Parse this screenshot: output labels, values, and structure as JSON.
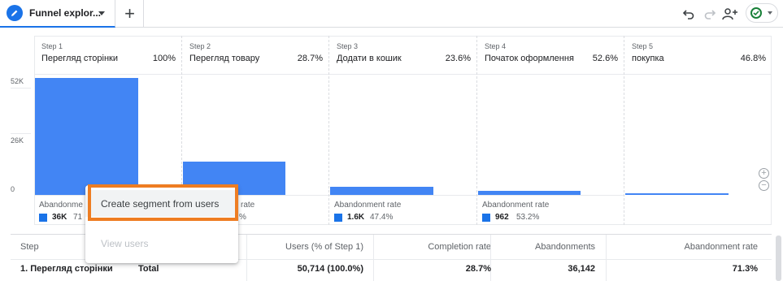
{
  "tab": {
    "title": "Funnel explor..."
  },
  "toolbar": {
    "undo": "undo-icon",
    "redo": "redo-icon",
    "share": "person-add-icon",
    "status": "check-circle-icon"
  },
  "accent": "#1a73e8",
  "bar_color": "#4285f4",
  "highlight_color": "#ee7d22",
  "yaxis": {
    "ticks": [
      "52K",
      "26K",
      "0"
    ]
  },
  "steps": [
    {
      "num": "Step 1",
      "name": "Перегляд сторінки",
      "pct": "100%",
      "ab_label": "Abandonment rate",
      "ab_value": "36K",
      "ab_rate": "71.3%"
    },
    {
      "num": "Step 2",
      "name": "Перегляд товару",
      "pct": "28.7%",
      "ab_label": "Abandonment rate",
      "ab_value": "",
      "ab_rate": ""
    },
    {
      "num": "Step 3",
      "name": "Додати в кошик",
      "pct": "23.6%",
      "ab_label": "Abandonment rate",
      "ab_value": "1.6K",
      "ab_rate": "47.4%"
    },
    {
      "num": "Step 4",
      "name": "Початок оформлення",
      "pct": "52.6%",
      "ab_label": "Abandonment rate",
      "ab_value": "962",
      "ab_rate": "53.2%"
    },
    {
      "num": "Step 5",
      "name": "покупка",
      "pct": "46.8%"
    }
  ],
  "partial": {
    "step1_ab_label": "Abandonme",
    "step1_ab_rate": "71",
    "step2_ab_label": "rate",
    "step2_ab_rate": "%"
  },
  "bars": {
    "step1": 50714,
    "step2": 14572,
    "step3": 3439,
    "step4": 1810,
    "step5": 847,
    "ymax": 52000
  },
  "menu": {
    "item1": "Create segment from users",
    "item2": "View users"
  },
  "table": {
    "headers": {
      "step": "Step",
      "users": "Users (% of Step 1)",
      "completion": "Completion rate",
      "abandonments": "Abandonments",
      "abandonment_rate": "Abandonment rate"
    },
    "row": {
      "step": "1. Перегляд сторінки",
      "segment": "Total",
      "users": "50,714 (100.0%)",
      "completion": "28.7%",
      "abandonments": "36,142",
      "abandonment_rate": "71.3%"
    }
  }
}
